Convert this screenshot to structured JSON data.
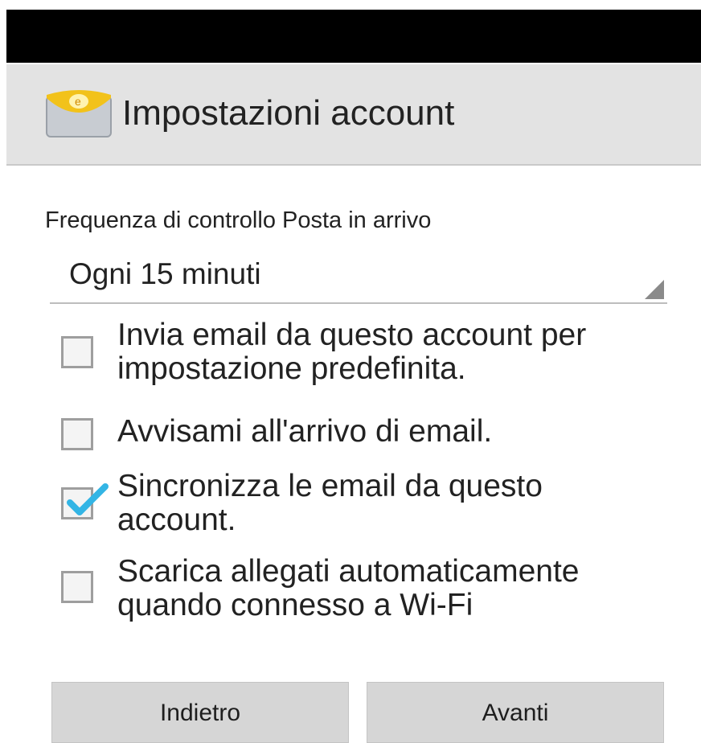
{
  "header": {
    "title": "Impostazioni account",
    "icon": "email-app-icon"
  },
  "frequency": {
    "label": "Frequenza di controllo Posta in arrivo",
    "selected": "Ogni 15 minuti"
  },
  "options": [
    {
      "line1": "Invia email da questo account per",
      "line2": "impostazione predefinita.",
      "checked": false
    },
    {
      "line1": "Avvisami all'arrivo di email.",
      "line2": "",
      "checked": false
    },
    {
      "line1": "Sincronizza le email da questo",
      "line2": "account.",
      "checked": true
    },
    {
      "line1": "Scarica allegati automaticamente",
      "line2": "quando connesso a Wi-Fi",
      "checked": false
    }
  ],
  "buttons": {
    "back": "Indietro",
    "next": "Avanti"
  },
  "colors": {
    "status_bar": "#000000",
    "action_bar": "#e3e3e3",
    "check_accent": "#33b5e5",
    "button_bg": "#d6d6d6"
  }
}
